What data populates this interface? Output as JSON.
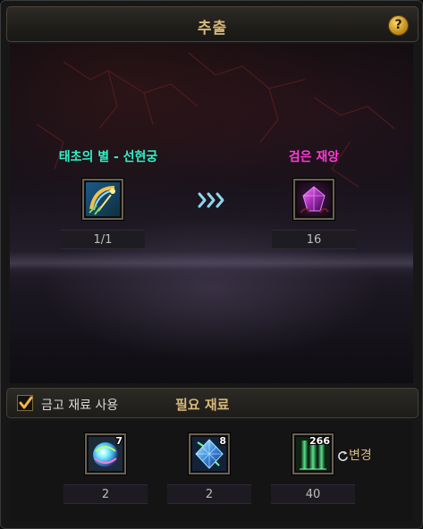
{
  "window": {
    "title": "추출",
    "help_label": "?"
  },
  "extraction": {
    "source": {
      "name": "태초의 별 - 선현궁",
      "count": "1/1",
      "icon": "golden-bow-icon",
      "color": "#31f0c6"
    },
    "arrow_icon": "triple-chevron-right-icon",
    "result": {
      "name": "검은 재앙",
      "count": "16",
      "icon": "dark-purple-gem-icon",
      "color": "#ff3ad8"
    }
  },
  "materials_bar": {
    "checkbox_label": "금고 재료 사용",
    "checked": true,
    "required_title": "필요 재료"
  },
  "materials": [
    {
      "icon": "rainbow-orb-icon",
      "stack": "7",
      "amount": "2"
    },
    {
      "icon": "blue-crystal-icon",
      "stack": "8",
      "amount": "2"
    },
    {
      "icon": "green-pillar-icon",
      "stack": "266",
      "amount": "40"
    }
  ],
  "change_button": {
    "label": "변경",
    "icon": "refresh-icon"
  },
  "colors": {
    "gold_text": "#d9b87a",
    "panel": "#171717"
  }
}
